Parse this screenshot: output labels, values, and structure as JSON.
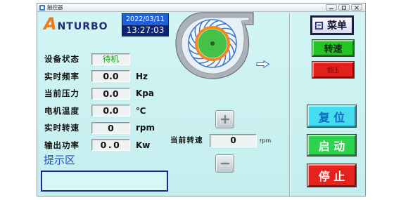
{
  "window": {
    "title": "触控器",
    "app_icon": "app-icon",
    "controls": [
      "minimize-icon",
      "maximize-icon",
      "close-icon"
    ]
  },
  "logo": {
    "text": "ANTURBO"
  },
  "datetime": {
    "date": "2022/03/11",
    "time": "13:27:03"
  },
  "fan": {
    "illustration": "centrifugal-blower-icon",
    "outlet_icon": "arrow-right-icon"
  },
  "status_panel": {
    "rows": [
      {
        "label": "设备状态",
        "value": "待机"
      },
      {
        "label": "实时频率",
        "value": "0.0",
        "unit": "Hz"
      },
      {
        "label": "当前压力",
        "value": "0.0",
        "unit": "Kpa"
      },
      {
        "label": "电机温度",
        "value": "0.0",
        "unit": "℃"
      },
      {
        "label": "实时转速",
        "value": "0",
        "unit": "rpm"
      },
      {
        "label": "输出功率",
        "value": "0.0",
        "unit": "Kw"
      }
    ]
  },
  "hint": {
    "label": "提示区"
  },
  "speed_control": {
    "label": "当前转速",
    "value": "0",
    "unit": "rpm",
    "increase_icon": "plus-icon",
    "decrease_icon": "minus-icon"
  },
  "menu": {
    "label": "菜单",
    "icon": "book-icon"
  },
  "mode_buttons": {
    "speed": "转速",
    "pressure": "恒压"
  },
  "actions": {
    "reset": "复 位",
    "start": "启 动",
    "stop": "停 止"
  },
  "colors": {
    "panel_bg": "#cbf1f1",
    "date_bg": "#2260d8",
    "time_bg": "#0d2470",
    "status_ok": "#159a15",
    "hint_label": "#1d4fd2",
    "hint_border": "#1b2a8c",
    "speed_mode": "#24c425",
    "pressure_mode": "#e2211c",
    "reset": "#44dcee",
    "reset_text": "#1962c6",
    "start": "#2dd24f",
    "stop": "#e5221d"
  }
}
